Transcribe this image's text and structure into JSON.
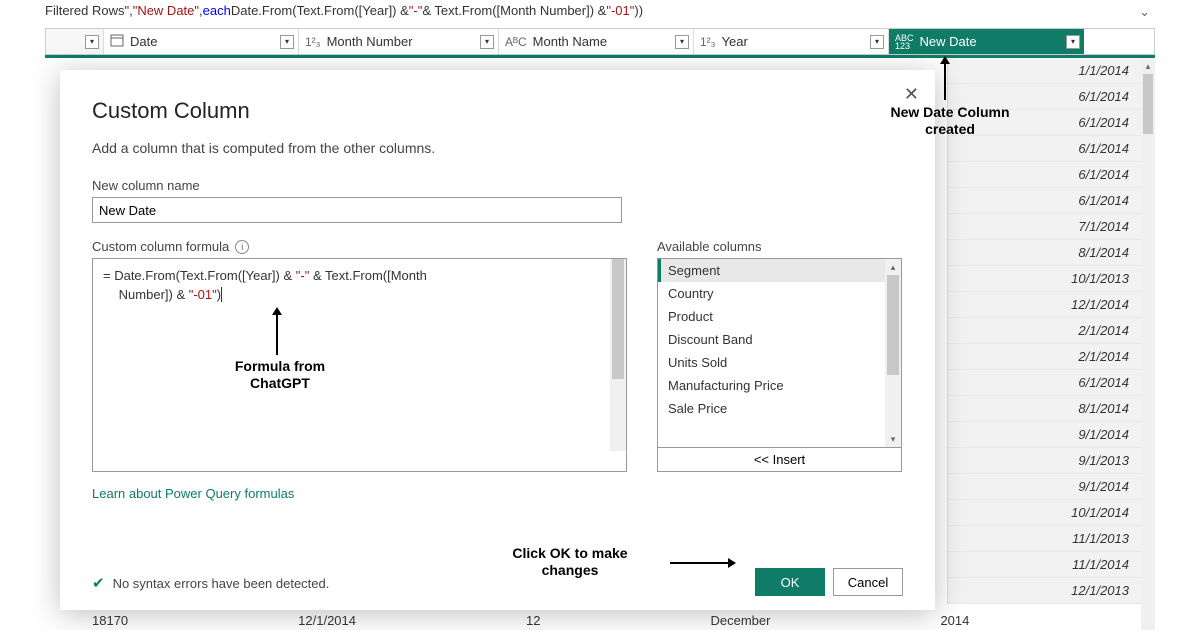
{
  "formula_bar": {
    "pre": "Filtered Rows\", ",
    "colname": "\"New Date\"",
    "comma": ", ",
    "each": "each",
    "rest": " Date.From(Text.From([Year]) & ",
    "dash": "\"-\"",
    "rest2": " & Text.From([Month Number]) & ",
    "end": "\"-01\"",
    "close": "))"
  },
  "columns": {
    "date": "Date",
    "month_number": "Month Number",
    "month_name": "Month Name",
    "year": "Year",
    "new_date": "New Date"
  },
  "type_icons": {
    "date": "📅",
    "number": "1²₃",
    "text": "AᴮC",
    "abc123": "ABC\n123"
  },
  "new_date_values": [
    "1/1/2014",
    "6/1/2014",
    "6/1/2014",
    "6/1/2014",
    "6/1/2014",
    "6/1/2014",
    "7/1/2014",
    "8/1/2014",
    "10/1/2013",
    "12/1/2014",
    "2/1/2014",
    "2/1/2014",
    "6/1/2014",
    "8/1/2014",
    "9/1/2014",
    "9/1/2013",
    "9/1/2014",
    "10/1/2014",
    "11/1/2013",
    "11/1/2014",
    "12/1/2013"
  ],
  "dialog": {
    "title": "Custom Column",
    "subtitle": "Add a column that is computed from the other columns.",
    "new_col_label": "New column name",
    "new_col_value": "New Date",
    "formula_label": "Custom column formula",
    "formula_line1_a": "= Date.From(Text.From([Year]) & ",
    "formula_line1_b": "\"-\"",
    "formula_line1_c": " & Text.From([Month",
    "formula_line2_a": "Number]) & ",
    "formula_line2_b": "\"-01\"",
    "formula_line2_c": ")",
    "available_label": "Available columns",
    "available": [
      "Segment",
      "Country",
      "Product",
      "Discount Band",
      "Units Sold",
      "Manufacturing Price",
      "Sale Price"
    ],
    "insert": "<< Insert",
    "learn": "Learn about Power Query formulas",
    "status": "No syntax errors have been detected.",
    "ok": "OK",
    "cancel": "Cancel"
  },
  "annotations": {
    "new_date": "New Date Column created",
    "formula": "Formula from ChatGPT",
    "click_ok": "Click OK to make changes"
  },
  "bottom_peek": [
    "18170",
    "12/1/2014",
    "12",
    "December",
    "2014"
  ]
}
